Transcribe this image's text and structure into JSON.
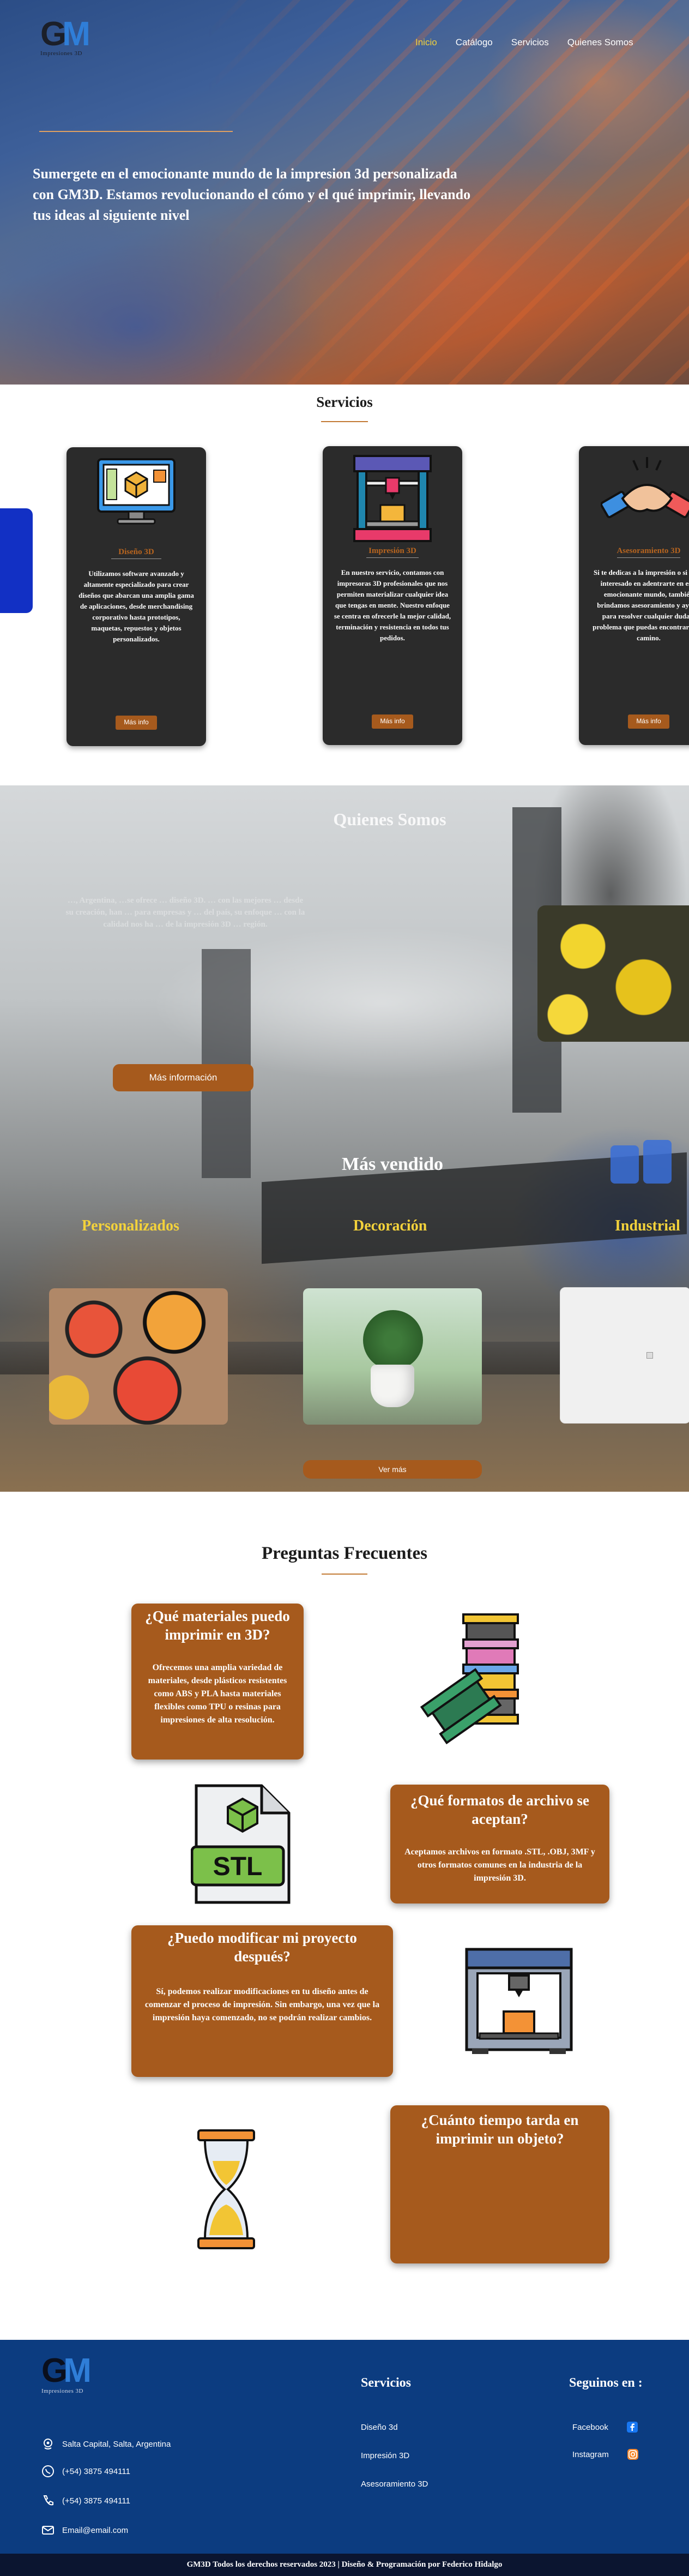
{
  "header": {
    "logo_letters": "GM",
    "logo_sub": "Impresiones 3D",
    "nav": [
      "Inicio",
      "Catálogo",
      "Servicios",
      "Quienes Somos"
    ],
    "active_nav": "Inicio"
  },
  "hero": {
    "text": "Sumergete en el emocionante mundo de la impresion 3d personalizada con GM3D. Estamos revolucionando el cómo y el qué imprimir, llevando tus ideas al siguiente nivel"
  },
  "services": {
    "title": "Servicios",
    "cards": [
      {
        "icon": "monitor-3d-icon",
        "title": "Diseño 3D",
        "text": "Utilizamos software avanzado y altamente especializado para crear diseños que abarcan una amplia gama de aplicaciones, desde merchandising corporativo hasta prototipos, maquetas, repuestos y objetos personalizados.",
        "button": "Más info"
      },
      {
        "icon": "printer-3d-icon",
        "title": "Impresión 3D",
        "text": "En nuestro servicio, contamos con impresoras 3D profesionales que nos permiten materializar cualquier idea que tengas en mente. Nuestro enfoque se centra en ofrecerle la mejor calidad, terminación y resistencia en todos tus pedidos.",
        "button": "Más info"
      },
      {
        "icon": "handshake-icon",
        "title": "Asesoramiento 3D",
        "text": "Si te dedicas a la impresión o si estás interesado en adentrarte en este emocionante mundo, también brindamos asesoramiento y ayuda para resolver cualquier duda o problema que puedas encontrar en el camino.",
        "button": "Más info"
      }
    ]
  },
  "about": {
    "title": "Quienes Somos",
    "text": "…, Argentina, …se ofrece … diseño 3D. … con las mejores … desde su creación, han … para empresas y … del país, su enfoque … con la calidad nos ha … de la impresión 3D … región.",
    "button": "Más información"
  },
  "best_sellers": {
    "title": "Más vendido",
    "categories": [
      "Personalizados",
      "Decoración",
      "Industrial"
    ],
    "button": "Ver más"
  },
  "faq": {
    "title": "Preguntas Frecuentes",
    "items": [
      {
        "q": "¿Qué materiales puedo imprimir en 3D?",
        "a": "Ofrecemos una amplia variedad de materiales, desde plásticos resistentes como ABS y PLA hasta materiales flexibles como TPU o resinas para impresiones de alta resolución."
      },
      {
        "q": "¿Qué formatos de archivo se aceptan?",
        "a": "Aceptamos archivos en formato .STL, .OBJ, 3MF y otros formatos comunes en la industria de la impresión 3D."
      },
      {
        "q": "¿Puedo modificar mi proyecto después?",
        "a": "Sí, podemos realizar modificaciones en tu diseño antes de comenzar el proceso de impresión. Sin embargo, una vez que la impresión haya comenzado, no se podrán realizar cambios."
      },
      {
        "q": "¿Cuánto tiempo tarda en imprimir un objeto?",
        "a": ""
      }
    ],
    "stl_label": "STL"
  },
  "footer": {
    "logo_letters": "GM",
    "logo_sub": "Impresiones 3D",
    "contact": [
      {
        "icon": "location-icon",
        "text": "Salta Capital, Salta,  Argentina"
      },
      {
        "icon": "whatsapp-icon",
        "text": "(+54) 3875 494111"
      },
      {
        "icon": "phone-icon",
        "text": "(+54) 3875 494111"
      },
      {
        "icon": "email-icon",
        "text": "Email@email.com"
      }
    ],
    "services_title": "Servicios",
    "services": [
      "Diseño 3d",
      "Impresión 3D",
      "Asesoramiento 3D"
    ],
    "social_title": "Seguinos en :",
    "social": [
      {
        "label": "Facebook",
        "icon": "facebook-icon",
        "color": "#1877f2"
      },
      {
        "label": "Instagram",
        "icon": "instagram-icon",
        "color": "#e1306c"
      }
    ],
    "copyright": "GM3D Todos los derechos reservados 2023  | Diseño & Programación por Federico Hidalgo"
  }
}
